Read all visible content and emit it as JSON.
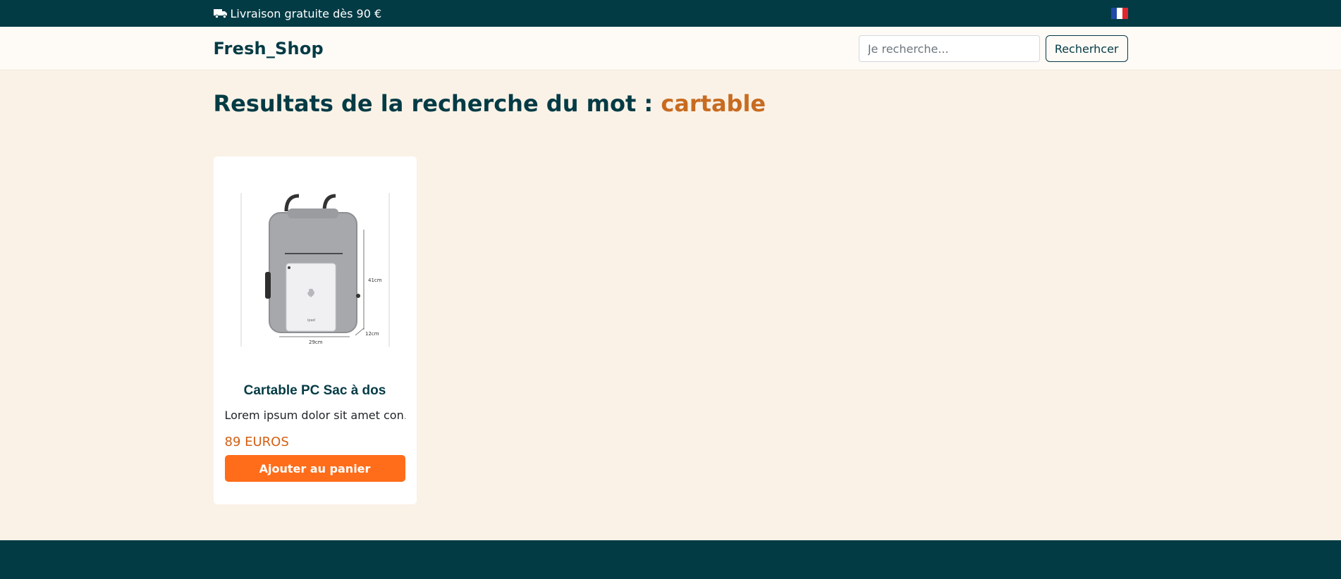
{
  "topbar": {
    "promo_icon": "truck-icon",
    "promo_text": "Livraison gratuite dès 90 €",
    "flag_icon": "france-flag-icon"
  },
  "header": {
    "brand": "Fresh_Shop",
    "search": {
      "placeholder": "Je recherche...",
      "value": "",
      "button_label": "Recherhcer"
    }
  },
  "results": {
    "title_prefix": "Resultats de la recherche du mot :",
    "keyword": "cartable"
  },
  "products": [
    {
      "title": "Cartable PC Sac à dos",
      "description": "Lorem ipsum dolor sit amet con...",
      "price": "89 EUROS",
      "button_label": "Ajouter au panier",
      "image_labels": {
        "height": "41cm",
        "width": "29cm",
        "depth": "12cm",
        "tablet": "ipad"
      }
    }
  ],
  "colors": {
    "primary": "#033b45",
    "accent": "#ff6d1a",
    "keyword": "#c86b20",
    "price": "#d35f13",
    "background": "#faf2e7"
  }
}
